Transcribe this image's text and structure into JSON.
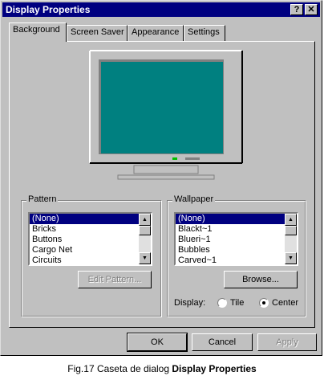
{
  "window": {
    "title": "Display Properties",
    "help_glyph": "?",
    "close_glyph": "✕"
  },
  "tabs": [
    {
      "label": "Background",
      "active": true
    },
    {
      "label": "Screen Saver",
      "active": false
    },
    {
      "label": "Appearance",
      "active": false
    },
    {
      "label": "Settings",
      "active": false
    }
  ],
  "monitor": {
    "screen_color": "#008080"
  },
  "pattern": {
    "label": "Pattern",
    "items": [
      "(None)",
      "Bricks",
      "Buttons",
      "Cargo Net",
      "Circuits"
    ],
    "selected_index": 0,
    "edit_button": "Edit Pattern..."
  },
  "wallpaper": {
    "label": "Wallpaper",
    "items": [
      "(None)",
      "Blackt~1",
      "Blueri~1",
      "Bubbles",
      "Carved~1"
    ],
    "selected_index": 0,
    "browse_button": "Browse...",
    "display_label": "Display:",
    "display_options": [
      {
        "label": "Tile",
        "checked": false
      },
      {
        "label": "Center",
        "checked": true
      }
    ]
  },
  "buttons": {
    "ok": "OK",
    "cancel": "Cancel",
    "apply": "Apply"
  },
  "caption": {
    "prefix": "Fig.17 Caseta de dialog ",
    "bold": "Display Properties"
  }
}
